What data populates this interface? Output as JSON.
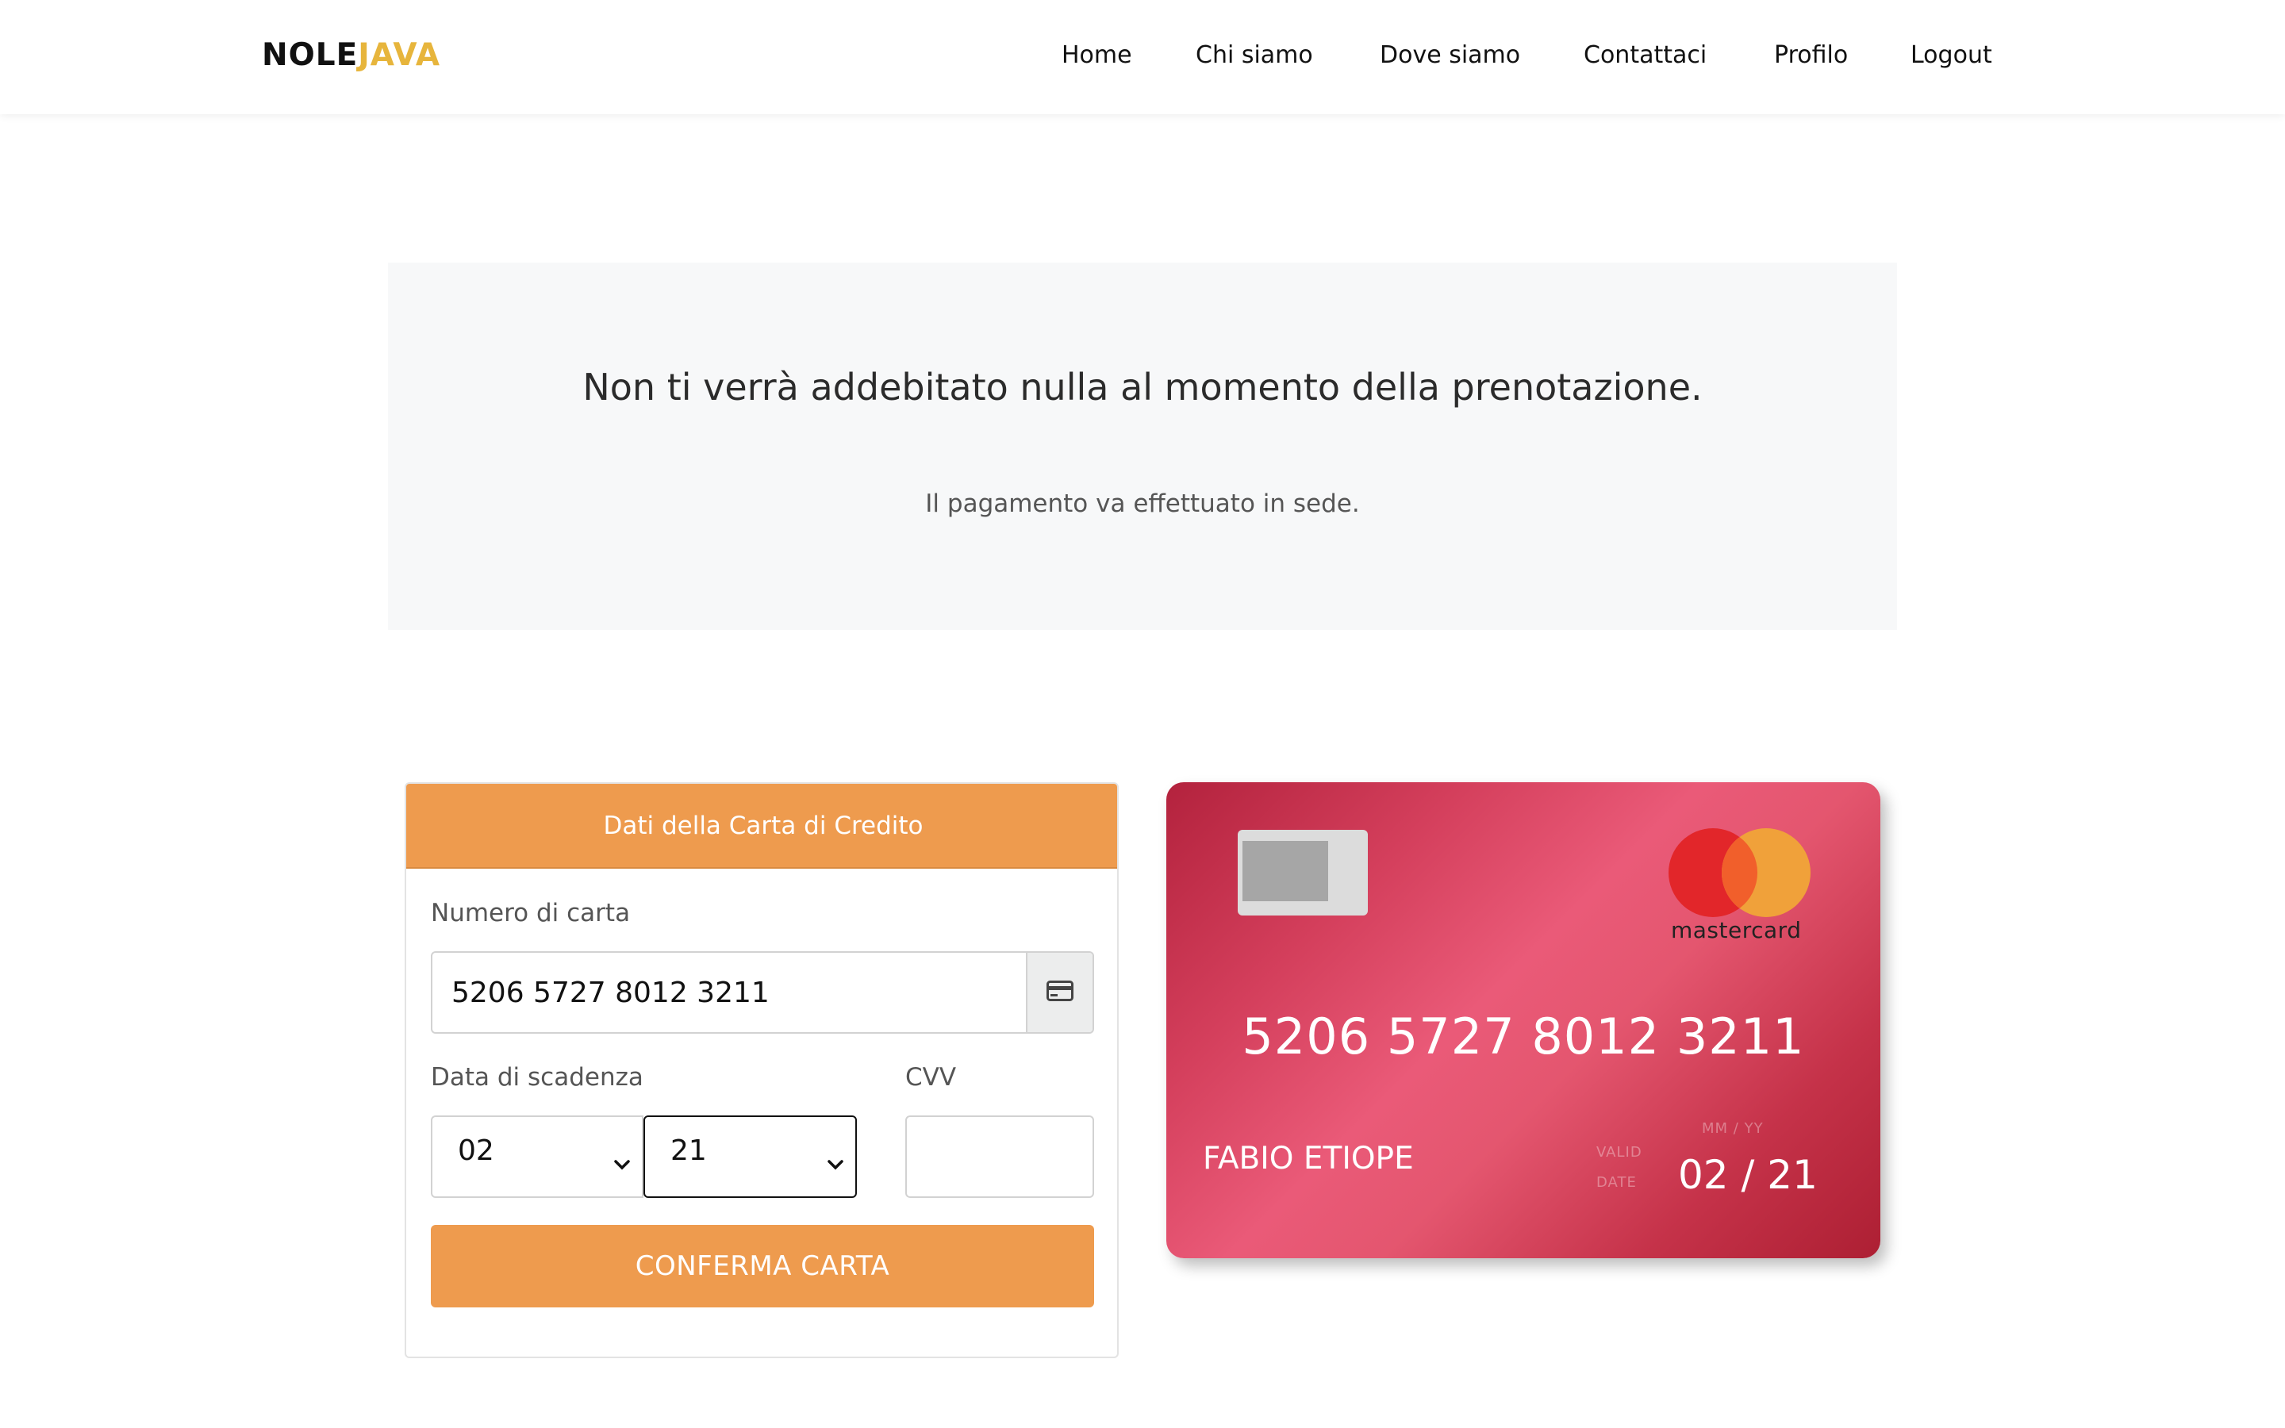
{
  "brand": {
    "part1": "NOLE",
    "part2": "JAVA",
    "accent_color": "#e7b53c"
  },
  "nav": {
    "items": [
      {
        "label": "Home"
      },
      {
        "label": "Chi siamo"
      },
      {
        "label": "Dove siamo"
      },
      {
        "label": "Contattaci"
      },
      {
        "label": "Profilo"
      },
      {
        "label": "Logout"
      }
    ]
  },
  "banner": {
    "title": "Non ti verrà addebitato nulla al momento della prenotazione.",
    "subtitle": "Il pagamento va effettuato in sede."
  },
  "form": {
    "header": "Dati della Carta di Credito",
    "card_number_label": "Numero di carta",
    "card_number_value": "5206 5727 8012 3211",
    "card_icon": "credit-card-icon",
    "expiry_label": "Data di scadenza",
    "expiry_month": "02",
    "expiry_year": "21",
    "cvv_label": "CVV",
    "cvv_value": "",
    "confirm_label": "CONFERMA CARTA",
    "accent_color": "#ee9b4e"
  },
  "card_preview": {
    "number": "5206 5727 8012 3211",
    "holder": "FABIO ETIOPE",
    "valid_line1": "VALID",
    "valid_line2": "DATE",
    "mmyy_label": "MM / YY",
    "expiry": "02 / 21",
    "network": "mastercard"
  }
}
